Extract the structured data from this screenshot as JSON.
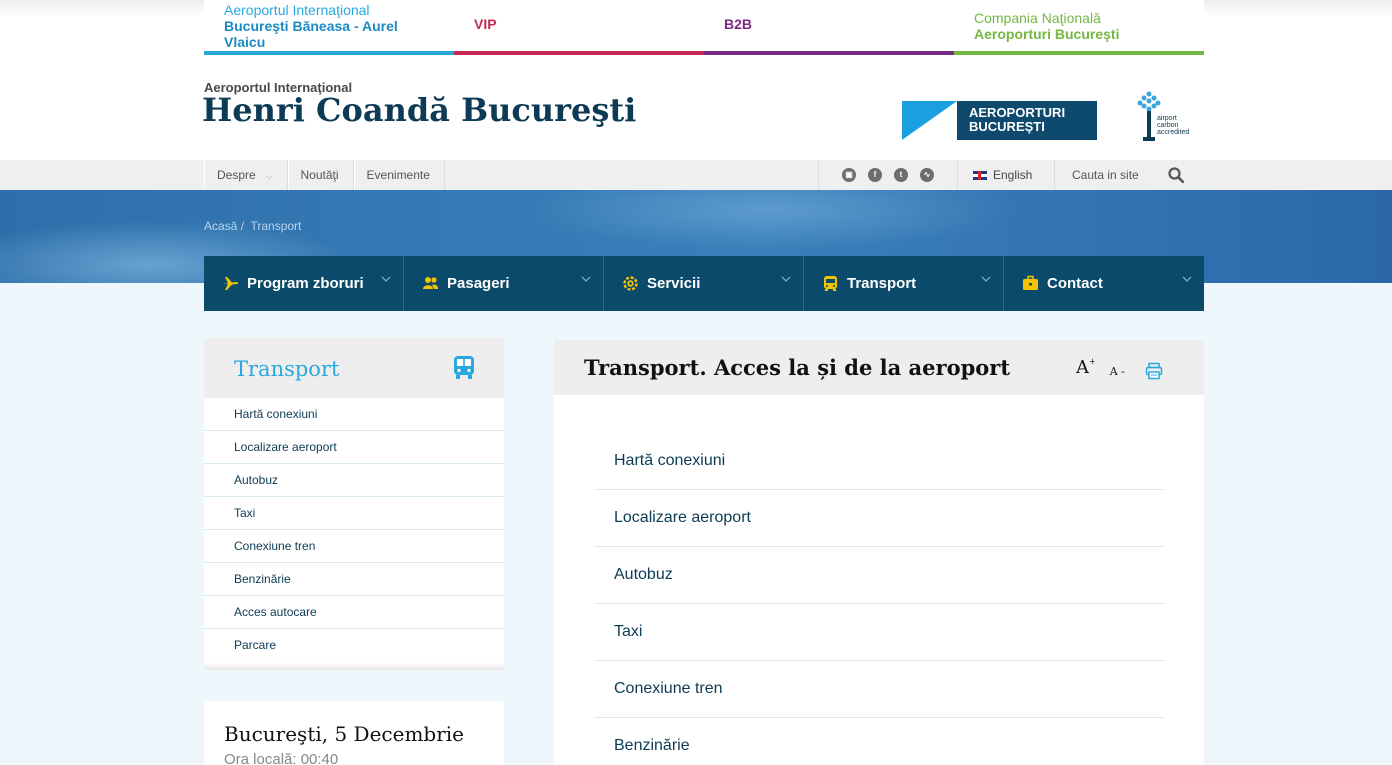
{
  "top_tabs": [
    {
      "small": "Aeroportul Internaţional",
      "big": "Bucureşti Băneasa - Aurel Vlaicu"
    },
    {
      "label": "VIP"
    },
    {
      "label": "B2B"
    },
    {
      "small": "Compania Naţională",
      "big": "Aeroporturi Bucureşti"
    }
  ],
  "header": {
    "subtitle": "Aeroportul Internaţional",
    "title": "Henri Coandă Bucureşti",
    "logo_line1": "AEROPORTURI",
    "logo_line2": "BUCUREŞTI",
    "carbon_text": [
      "airport",
      "carbon",
      "accredited"
    ]
  },
  "utility": {
    "menu": [
      "Despre",
      "Noutăţi",
      "Evenimente"
    ],
    "social_icons": [
      "instagram-icon",
      "facebook-icon",
      "twitter-icon",
      "rss-icon"
    ],
    "language": "English",
    "search_placeholder": "Cauta in site"
  },
  "breadcrumb": [
    "Acasă",
    "Transport"
  ],
  "main_nav": [
    {
      "label": "Program zboruri",
      "icon": "plane-icon"
    },
    {
      "label": "Pasageri",
      "icon": "people-icon"
    },
    {
      "label": "Servicii",
      "icon": "gear-icon"
    },
    {
      "label": "Transport",
      "icon": "bus-icon"
    },
    {
      "label": "Contact",
      "icon": "briefcase-icon"
    }
  ],
  "sidebar": {
    "title": "Transport",
    "items": [
      "Hartă conexiuni",
      "Localizare aeroport",
      "Autobuz",
      "Taxi",
      "Conexiune tren",
      "Benzinărie",
      "Acces autocare",
      "Parcare"
    ]
  },
  "date_box": {
    "title": "Bucureşti, 5 Decembrie",
    "local_time": "Ora locală: 00:40"
  },
  "content": {
    "title": "Transport. Acces la și de la aeroport",
    "font_increase": "A",
    "font_decrease": "A",
    "items": [
      "Hartă conexiuni",
      "Localizare aeroport",
      "Autobuz",
      "Taxi",
      "Conexiune tren",
      "Benzinărie"
    ]
  },
  "colors": {
    "navy": "#0c4a6b",
    "accent_blue": "#29a8e0",
    "vip": "#c62a54",
    "b2b": "#7a2a82",
    "green": "#74b843"
  }
}
